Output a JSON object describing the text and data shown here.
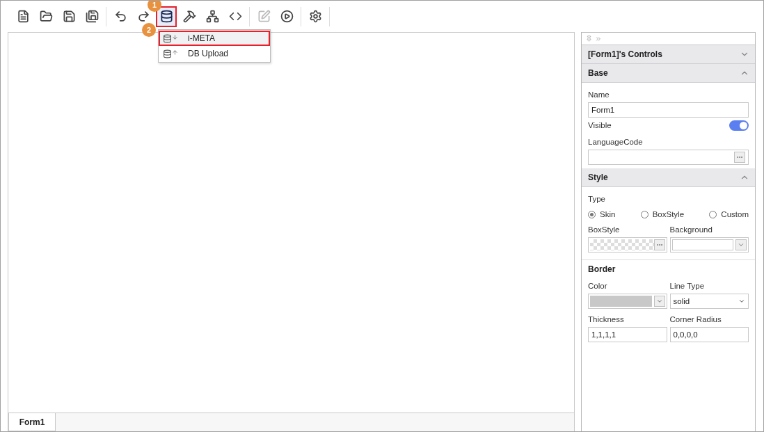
{
  "toolbar": {
    "groups": [
      [
        {
          "kind": "new",
          "selected": false,
          "disabled": false
        },
        {
          "kind": "open",
          "selected": false,
          "disabled": false
        },
        {
          "kind": "save",
          "selected": false,
          "disabled": false
        },
        {
          "kind": "saveall",
          "selected": false,
          "disabled": false
        }
      ],
      [
        {
          "kind": "undo",
          "selected": false,
          "disabled": false
        },
        {
          "kind": "redo",
          "selected": false,
          "disabled": false
        },
        {
          "kind": "database",
          "selected": true,
          "disabled": false,
          "callout": "1"
        },
        {
          "kind": "tools",
          "selected": false,
          "disabled": false
        },
        {
          "kind": "hierarchy",
          "selected": false,
          "disabled": false
        },
        {
          "kind": "code",
          "selected": false,
          "disabled": false
        }
      ],
      [
        {
          "kind": "edit",
          "selected": false,
          "disabled": true
        },
        {
          "kind": "play",
          "selected": false,
          "disabled": false
        }
      ],
      [
        {
          "kind": "settings",
          "selected": false,
          "disabled": false
        }
      ]
    ]
  },
  "menu": {
    "items": [
      {
        "label": "i-META",
        "kind": "download",
        "selected": true,
        "callout": "2"
      },
      {
        "label": "DB Upload",
        "kind": "upload",
        "selected": false
      }
    ]
  },
  "canvas": {
    "tabs": [
      {
        "label": "Form1",
        "selected": true
      }
    ]
  },
  "panel": {
    "controls_title": "[Form1]'s Controls",
    "controls_expanded": false,
    "base": {
      "title": "Base",
      "expanded": true,
      "name_label": "Name",
      "name_value": "Form1",
      "visible_label": "Visible",
      "visible_on": true,
      "language_label": "LanguageCode"
    },
    "style": {
      "title": "Style",
      "expanded": true,
      "type_label": "Type",
      "type_options": [
        {
          "label": "Skin",
          "selected": true
        },
        {
          "label": "BoxStyle",
          "selected": false
        },
        {
          "label": "Custom",
          "selected": false
        }
      ],
      "boxstyle_label": "BoxStyle",
      "background_label": "Background",
      "border_title": "Border",
      "color_label": "Color",
      "line_type_label": "Line Type",
      "line_type_value": "solid",
      "thickness_label": "Thickness",
      "thickness_value": "1,1,1,1",
      "corner_label": "Corner Radius",
      "corner_value": "0,0,0,0"
    }
  }
}
